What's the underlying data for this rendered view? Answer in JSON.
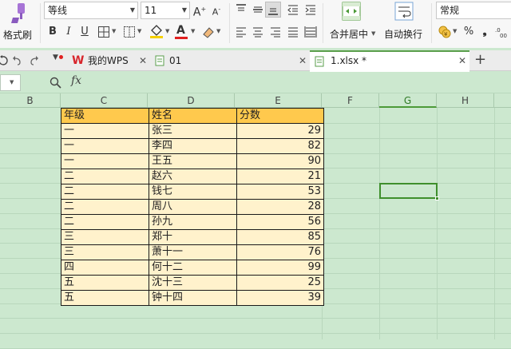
{
  "ribbon": {
    "format_painter_label": "格式刷",
    "font_name": "等线",
    "font_size": "11",
    "bold": "B",
    "italic": "I",
    "underline": "U",
    "grow_font": "A",
    "shrink_font": "A",
    "merge_center_label": "合并居中",
    "wrap_text_label": "自动换行",
    "number_format": "常规",
    "percent": "%",
    "comma": "❟",
    "fill_color": "#f5d000",
    "font_color": "#e02020"
  },
  "tabs": [
    {
      "label": "我的WPS"
    },
    {
      "label": "01"
    },
    {
      "label": "1.xlsx *"
    }
  ],
  "formula_bar": {
    "fx_label": "fx",
    "value": ""
  },
  "columns": [
    "B",
    "C",
    "D",
    "E",
    "F",
    "G",
    "H"
  ],
  "selected_column": "G",
  "table": {
    "headers": [
      "年级",
      "姓名",
      "分数"
    ],
    "rows": [
      [
        "一",
        "张三",
        "29"
      ],
      [
        "一",
        "李四",
        "82"
      ],
      [
        "一",
        "王五",
        "90"
      ],
      [
        "二",
        "赵六",
        "21"
      ],
      [
        "二",
        "钱七",
        "53"
      ],
      [
        "二",
        "周八",
        "28"
      ],
      [
        "二",
        "孙九",
        "56"
      ],
      [
        "三",
        "郑十",
        "85"
      ],
      [
        "三",
        "萧十一",
        "76"
      ],
      [
        "四",
        "何十二",
        "99"
      ],
      [
        "五",
        "沈十三",
        "25"
      ],
      [
        "五",
        "钟十四",
        "39"
      ]
    ]
  }
}
